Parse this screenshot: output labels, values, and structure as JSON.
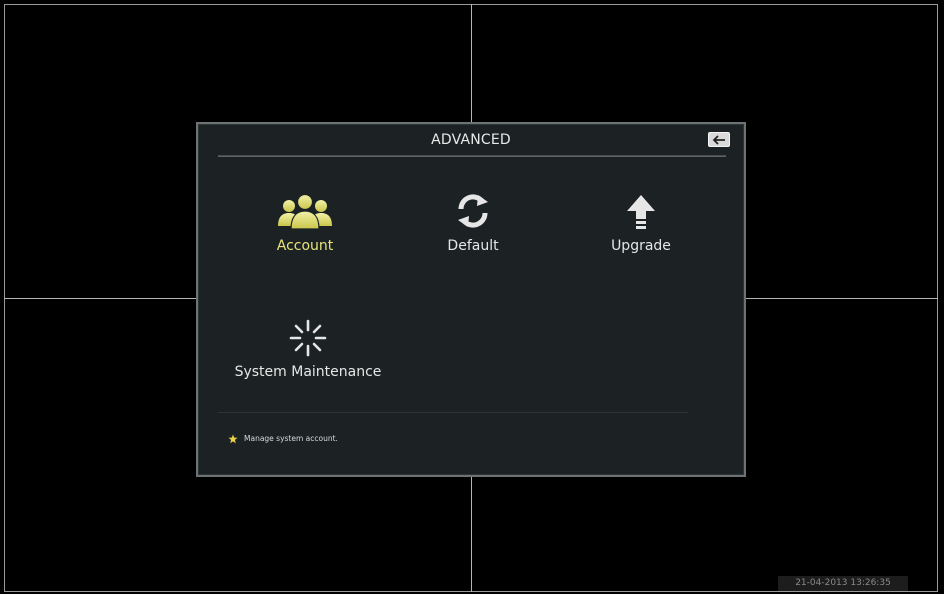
{
  "dialog": {
    "title": "ADVANCED",
    "items": [
      {
        "label": "Account",
        "icon": "account-users-icon",
        "active": true
      },
      {
        "label": "Default",
        "icon": "refresh-icon",
        "active": false
      },
      {
        "label": "Upgrade",
        "icon": "upgrade-arrow-icon",
        "active": false
      },
      {
        "label": "System Maintenance",
        "icon": "maintenance-spinner-icon",
        "active": false
      }
    ],
    "hint": "Manage system account."
  },
  "status": {
    "datetime": "21-04-2013 13:26:35"
  },
  "colors": {
    "active_label": "#e7e37a",
    "icon_active": "#e8e56a",
    "dialog_bg": "#1c2224"
  }
}
